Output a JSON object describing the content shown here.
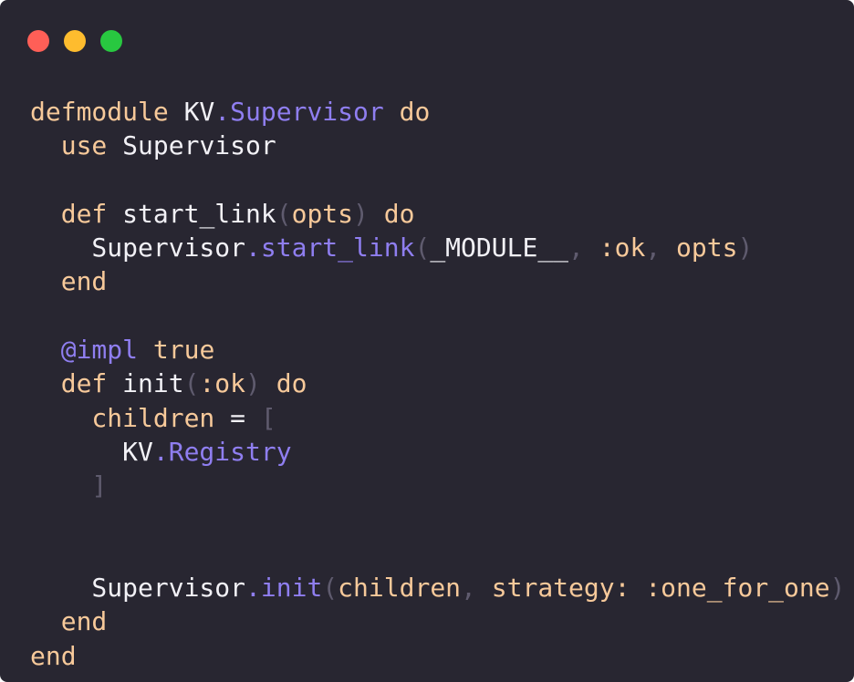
{
  "window": {
    "traffic_lights": [
      {
        "name": "close",
        "color": "#ff5f57"
      },
      {
        "name": "minimize",
        "color": "#febc2e"
      },
      {
        "name": "maximize",
        "color": "#28c840"
      }
    ]
  },
  "colors": {
    "background": "#282631",
    "plain": "#f2f1f6",
    "keyword": "#f7c99a",
    "type": "#8f7ef0",
    "punct": "#5f5b6e"
  },
  "code": {
    "lines": [
      [
        {
          "t": "defmodule",
          "c": "keyword"
        },
        {
          "t": " KV",
          "c": "plain"
        },
        {
          "t": ".Supervisor",
          "c": "type"
        },
        {
          "t": " do",
          "c": "keyword"
        }
      ],
      [
        {
          "t": "  use",
          "c": "keyword"
        },
        {
          "t": " Supervisor",
          "c": "plain"
        }
      ],
      [],
      [
        {
          "t": "  def",
          "c": "keyword"
        },
        {
          "t": " start_link",
          "c": "plain"
        },
        {
          "t": "(",
          "c": "punct"
        },
        {
          "t": "opts",
          "c": "keyword"
        },
        {
          "t": ")",
          "c": "punct"
        },
        {
          "t": " do",
          "c": "keyword"
        }
      ],
      [
        {
          "t": "    Supervisor",
          "c": "plain"
        },
        {
          "t": ".start_link",
          "c": "type"
        },
        {
          "t": "(",
          "c": "punct"
        },
        {
          "t": "_MODULE__",
          "c": "plain"
        },
        {
          "t": ", ",
          "c": "punct"
        },
        {
          "t": ":ok",
          "c": "keyword"
        },
        {
          "t": ", ",
          "c": "punct"
        },
        {
          "t": "opts",
          "c": "keyword"
        },
        {
          "t": ")",
          "c": "punct"
        }
      ],
      [
        {
          "t": "  end",
          "c": "keyword"
        }
      ],
      [],
      [
        {
          "t": "  @impl",
          "c": "type"
        },
        {
          "t": " true",
          "c": "keyword"
        }
      ],
      [
        {
          "t": "  def",
          "c": "keyword"
        },
        {
          "t": " init",
          "c": "plain"
        },
        {
          "t": "(",
          "c": "punct"
        },
        {
          "t": ":ok",
          "c": "keyword"
        },
        {
          "t": ")",
          "c": "punct"
        },
        {
          "t": " do",
          "c": "keyword"
        }
      ],
      [
        {
          "t": "    children",
          "c": "keyword"
        },
        {
          "t": " = ",
          "c": "plain"
        },
        {
          "t": "[",
          "c": "punct"
        }
      ],
      [
        {
          "t": "      KV",
          "c": "plain"
        },
        {
          "t": ".Registry",
          "c": "type"
        }
      ],
      [
        {
          "t": "    ]",
          "c": "punct"
        }
      ],
      [],
      [],
      [
        {
          "t": "    Supervisor",
          "c": "plain"
        },
        {
          "t": ".init",
          "c": "type"
        },
        {
          "t": "(",
          "c": "punct"
        },
        {
          "t": "children",
          "c": "keyword"
        },
        {
          "t": ", ",
          "c": "punct"
        },
        {
          "t": "strategy:",
          "c": "keyword"
        },
        {
          "t": " :one_for_one",
          "c": "keyword"
        },
        {
          "t": ")",
          "c": "punct"
        }
      ],
      [
        {
          "t": "  end",
          "c": "keyword"
        }
      ],
      [
        {
          "t": "end",
          "c": "keyword"
        }
      ]
    ]
  }
}
